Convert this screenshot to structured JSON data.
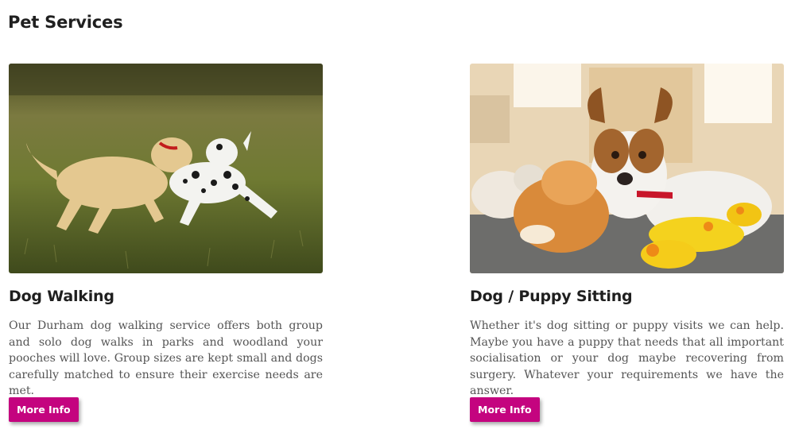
{
  "section": {
    "title": "Pet Services"
  },
  "cards": [
    {
      "image_alt": "Two dogs running on grass",
      "title": "Dog Walking",
      "text": "Our Durham dog walking service offers both group and solo dog walks in parks and woodland your pooches will love. Group sizes are kept small and dogs carefully matched to ensure their exercise needs are met.",
      "button_label": "More Info"
    },
    {
      "image_alt": "Puppy lying with plush toys",
      "title": "Dog / Puppy Sitting",
      "text": "Whether it's dog sitting or puppy visits we can help. Maybe you have a puppy that needs that all important socialisation or your dog maybe recovering from surgery. Whatever your requirements we have the answer.",
      "button_label": "More Info"
    }
  ],
  "colors": {
    "button_bg": "#c4047f",
    "heading": "#1f1f1f",
    "body_text": "#555555"
  }
}
